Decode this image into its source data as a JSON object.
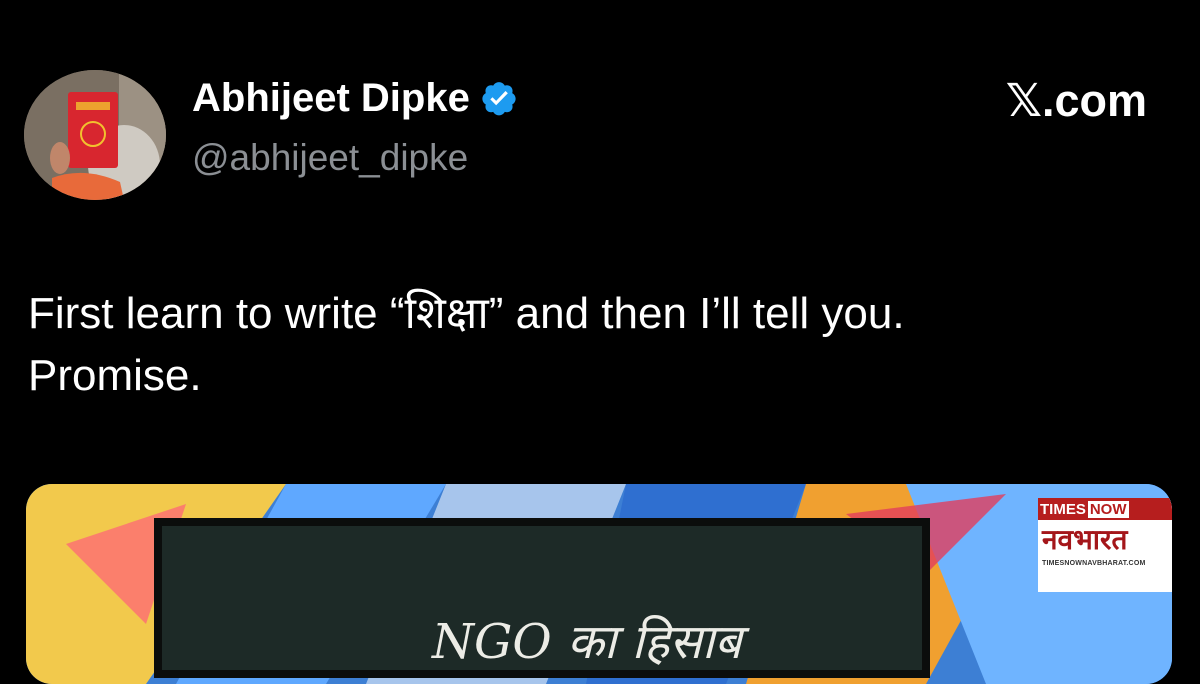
{
  "post": {
    "author": {
      "display_name": "Abhijeet Dipke",
      "handle": "@abhijeet_dipke",
      "verified": true,
      "verified_color": "#1d9bf0",
      "avatar_icon": "profile-photo"
    },
    "source_brand": "𝕏.com",
    "text_lines": [
      "First learn to write “शिक्षा” and then I’ll tell you.",
      "Promise."
    ],
    "media": {
      "board_text": "NGO का हिसाब",
      "logo": {
        "top_left": "TIMES",
        "top_right": "NOW",
        "title": "नवभारत",
        "url": "TIMESNOWNAVBHARAT.COM"
      }
    }
  },
  "theme": {
    "background": "#000000",
    "text": "#ffffff",
    "secondary_text": "#8b8f94"
  }
}
